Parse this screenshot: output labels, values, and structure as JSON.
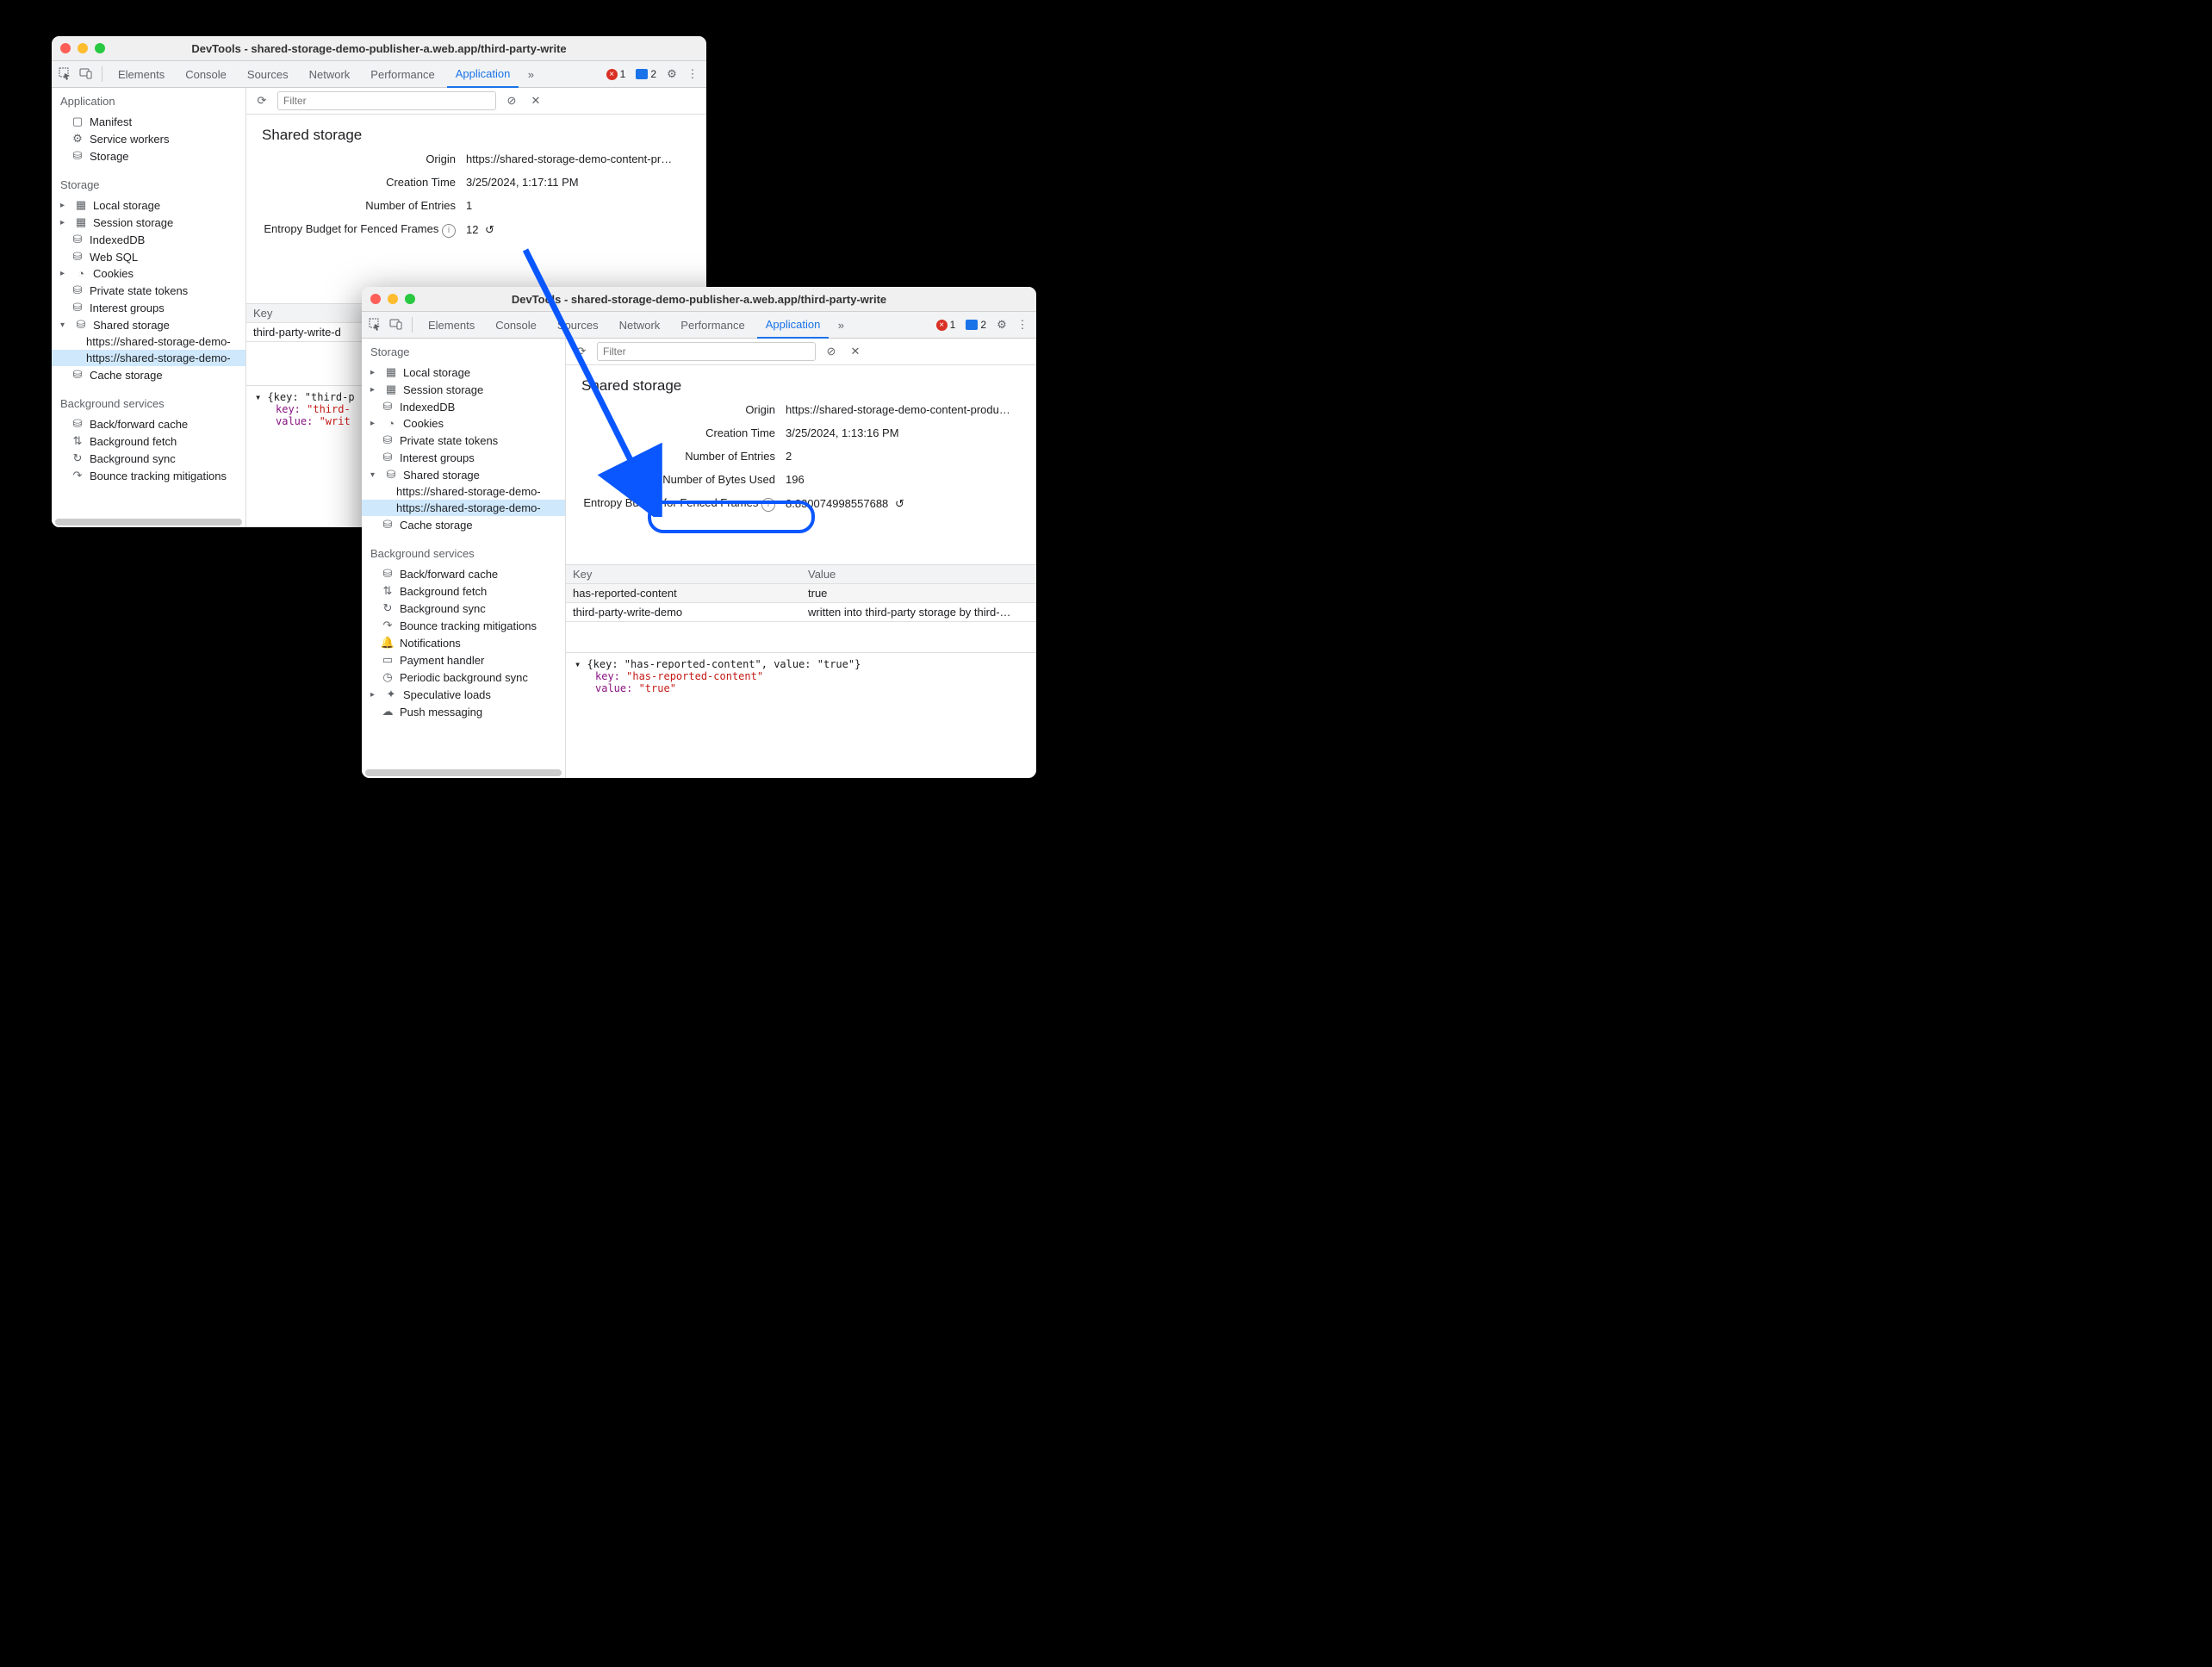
{
  "window1": {
    "title": "DevTools - shared-storage-demo-publisher-a.web.app/third-party-write",
    "tabs": [
      "Elements",
      "Console",
      "Sources",
      "Network",
      "Performance",
      "Application"
    ],
    "active_tab": "Application",
    "errors": "1",
    "messages": "2",
    "filter_placeholder": "Filter",
    "sidebar": {
      "section_app": "Application",
      "items_app": [
        "Manifest",
        "Service workers",
        "Storage"
      ],
      "section_storage": "Storage",
      "items_storage": [
        "Local storage",
        "Session storage",
        "IndexedDB",
        "Web SQL",
        "Cookies",
        "Private state tokens",
        "Interest groups",
        "Shared storage"
      ],
      "shared_children": [
        "https://shared-storage-demo-",
        "https://shared-storage-demo-"
      ],
      "cache_storage": "Cache storage",
      "section_bg": "Background services",
      "items_bg": [
        "Back/forward cache",
        "Background fetch",
        "Background sync",
        "Bounce tracking mitigations"
      ]
    },
    "panel": {
      "title": "Shared storage",
      "origin_label": "Origin",
      "origin_value": "https://shared-storage-demo-content-pr…",
      "creation_label": "Creation Time",
      "creation_value": "3/25/2024, 1:17:11 PM",
      "entries_label": "Number of Entries",
      "entries_value": "1",
      "entropy_label": "Entropy Budget for Fenced Frames",
      "entropy_value": "12",
      "table": {
        "hkey": "Key",
        "rows": [
          {
            "key": "third-party-write-d"
          }
        ]
      },
      "preview_line1": "▾ {key: \"third-p",
      "preview_k1": "key: ",
      "preview_v1": "\"third-",
      "preview_k2": "value: ",
      "preview_v2": "\"writ"
    }
  },
  "window2": {
    "title": "DevTools - shared-storage-demo-publisher-a.web.app/third-party-write",
    "tabs": [
      "Elements",
      "Console",
      "Sources",
      "Network",
      "Performance",
      "Application"
    ],
    "active_tab": "Application",
    "errors": "1",
    "messages": "2",
    "filter_placeholder": "Filter",
    "sidebar": {
      "section_storage": "Storage",
      "items_storage": [
        "Local storage",
        "Session storage",
        "IndexedDB",
        "Cookies",
        "Private state tokens",
        "Interest groups",
        "Shared storage"
      ],
      "shared_children": [
        "https://shared-storage-demo-",
        "https://shared-storage-demo-"
      ],
      "cache_storage": "Cache storage",
      "section_bg": "Background services",
      "items_bg": [
        "Back/forward cache",
        "Background fetch",
        "Background sync",
        "Bounce tracking mitigations",
        "Notifications",
        "Payment handler",
        "Periodic background sync",
        "Speculative loads",
        "Push messaging"
      ]
    },
    "panel": {
      "title": "Shared storage",
      "origin_label": "Origin",
      "origin_value": "https://shared-storage-demo-content-produ…",
      "creation_label": "Creation Time",
      "creation_value": "3/25/2024, 1:13:16 PM",
      "entries_label": "Number of Entries",
      "entries_value": "2",
      "bytes_label": "Number of Bytes Used",
      "bytes_value": "196",
      "entropy_label": "Entropy Budget for Fenced Frames",
      "entropy_value": "8.830074998557688",
      "table": {
        "hkey": "Key",
        "hval": "Value",
        "rows": [
          {
            "key": "has-reported-content",
            "value": "true"
          },
          {
            "key": "third-party-write-demo",
            "value": "written into third-party storage by third-…"
          }
        ]
      },
      "preview_line1": "▾ {key: \"has-reported-content\", value: \"true\"}",
      "preview_k1": "key: ",
      "preview_v1": "\"has-reported-content\"",
      "preview_k2": "value: ",
      "preview_v2": "\"true\""
    }
  }
}
